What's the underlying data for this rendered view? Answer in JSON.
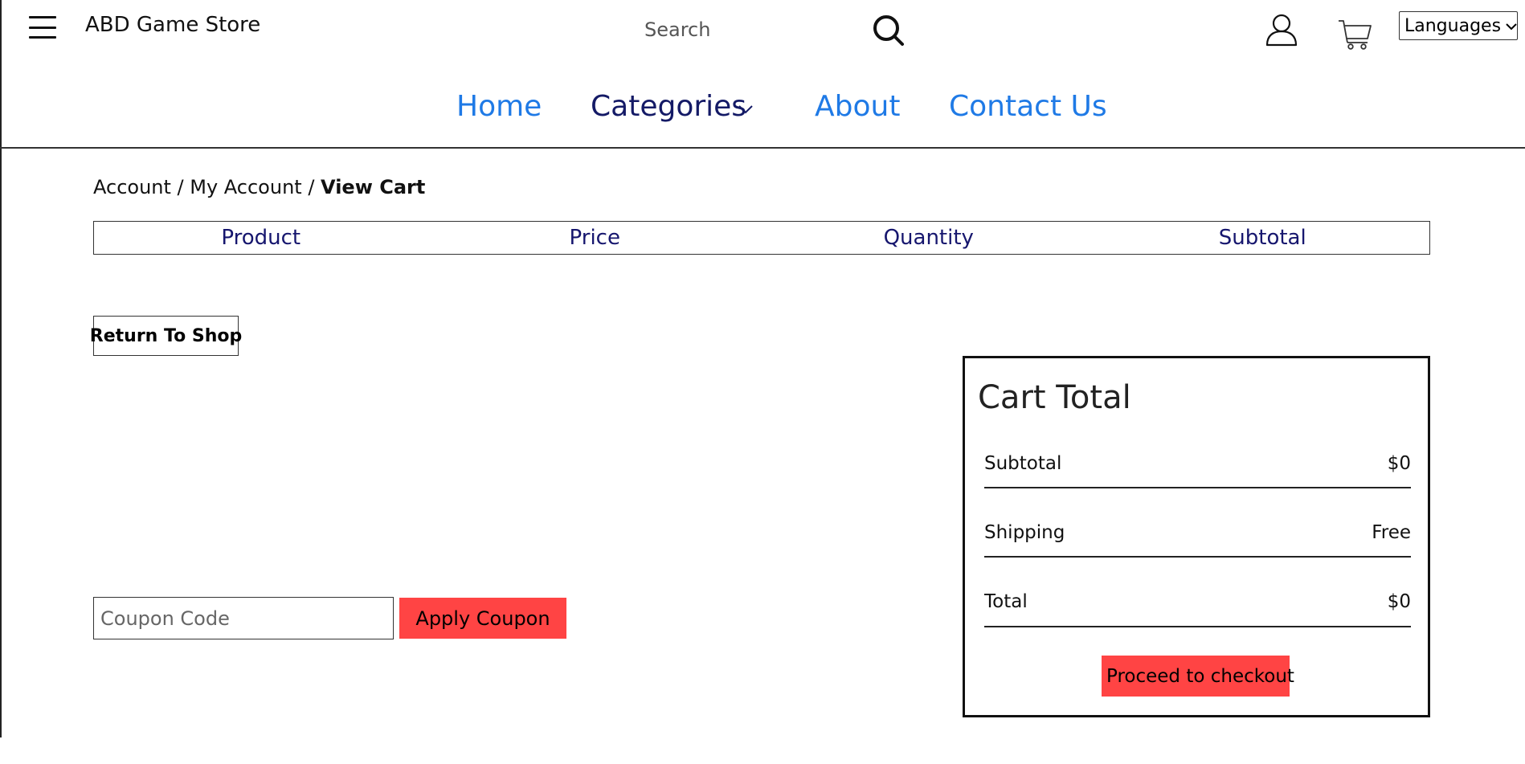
{
  "header": {
    "brand": "ABD Game Store",
    "search_placeholder": "Search",
    "languages_label": "Languages"
  },
  "nav": {
    "home": "Home",
    "categories": "Categories",
    "about": "About",
    "contact": "Contact Us"
  },
  "breadcrumb": {
    "items": [
      "Account",
      "My Account"
    ],
    "separator": " / ",
    "current": "View Cart"
  },
  "cart_table": {
    "columns": [
      "Product",
      "Price",
      "Quantity",
      "Subtotal"
    ]
  },
  "actions": {
    "return_to_shop": "Return To Shop",
    "coupon_placeholder": "Coupon Code",
    "apply_coupon": "Apply Coupon"
  },
  "cart_total": {
    "title": "Cart Total",
    "rows": [
      {
        "label": "Subtotal",
        "value": "$0"
      },
      {
        "label": "Shipping",
        "value": "Free"
      },
      {
        "label": "Total",
        "value": "$0"
      }
    ],
    "checkout_label": "Proceed to checkout"
  },
  "colors": {
    "accent_blue": "#1f7ae6",
    "nav_dark": "#141a66",
    "table_header_text": "#16166e",
    "button_red": "#ff4444"
  },
  "icons": [
    "menu-icon",
    "search-icon",
    "user-icon",
    "cart-icon",
    "chevron-down-icon"
  ]
}
